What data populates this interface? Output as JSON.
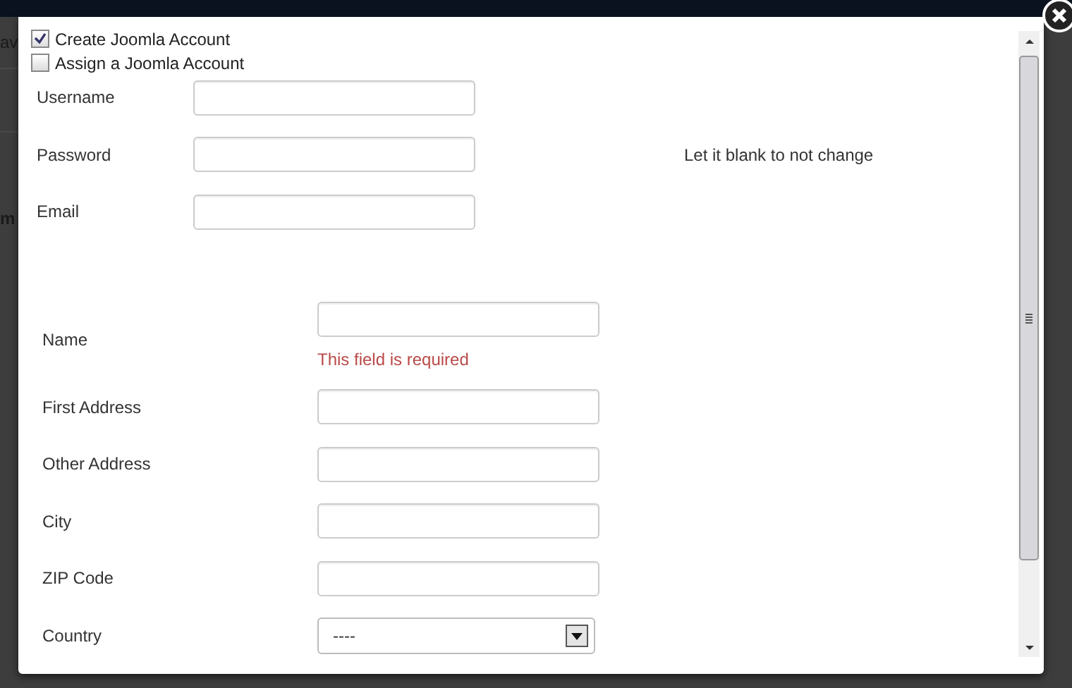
{
  "background": {
    "fragments": [
      "av",
      "m"
    ]
  },
  "modal": {
    "checkboxes": [
      {
        "label": "Create Joomla Account",
        "checked": true
      },
      {
        "label": "Assign a Joomla Account",
        "checked": false
      }
    ],
    "account_fields": [
      {
        "label": "Username"
      },
      {
        "label": "Password",
        "hint": "Let it blank to not change"
      },
      {
        "label": "Email"
      }
    ],
    "address_fields": [
      {
        "label": "Name",
        "kind": "text",
        "error": "This field is required"
      },
      {
        "label": "First Address",
        "kind": "text"
      },
      {
        "label": "Other Address",
        "kind": "text"
      },
      {
        "label": "City",
        "kind": "text"
      },
      {
        "label": "ZIP Code",
        "kind": "text"
      },
      {
        "label": "Country",
        "kind": "select",
        "value": "----"
      }
    ]
  }
}
